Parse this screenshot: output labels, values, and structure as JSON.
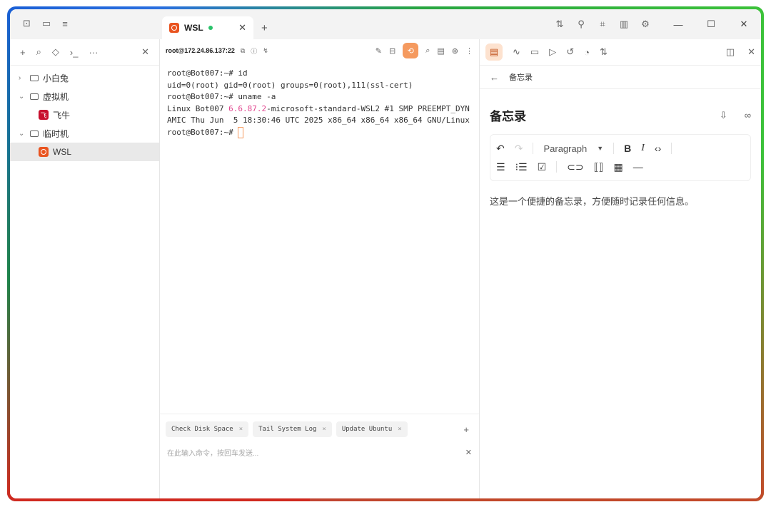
{
  "tab": {
    "title": "WSL"
  },
  "sidebar": {
    "items": [
      {
        "label": "小白兔",
        "expanded": false
      },
      {
        "label": "虚拟机",
        "expanded": true,
        "children": [
          {
            "label": "飞牛"
          }
        ]
      },
      {
        "label": "临时机",
        "expanded": true,
        "children": [
          {
            "label": "WSL"
          }
        ]
      }
    ]
  },
  "terminal": {
    "host": "root@172.24.86.137:22",
    "lines": [
      "root@Bot007:~# id",
      "uid=0(root) gid=0(root) groups=0(root),111(ssl-cert)",
      "root@Bot007:~# uname -a"
    ],
    "uname_prefix": "Linux Bot007 ",
    "kernel_version": "6.6.87.2",
    "uname_suffix": "-microsoft-standard-WSL2 #1 SMP PREEMPT_DYNAMIC Thu Jun  5 18:30:46 UTC 2025 x86_64 x86_64 x86_64 GNU/Linux",
    "prompt": "root@Bot007:~# "
  },
  "quick_commands": [
    "Check Disk Space",
    "Tail System Log",
    "Update Ubuntu"
  ],
  "command_input": {
    "placeholder": "在此输入命令，按回车发送..."
  },
  "notes": {
    "breadcrumb": "备忘录",
    "title": "备忘录",
    "block_type": "Paragraph",
    "content": "这是一个便捷的备忘录，方便随时记录任何信息。"
  },
  "colors": {
    "accent": "#f59a5f",
    "ubuntu": "#e95420",
    "highlight": "#e2468f",
    "online": "#29c26a"
  }
}
